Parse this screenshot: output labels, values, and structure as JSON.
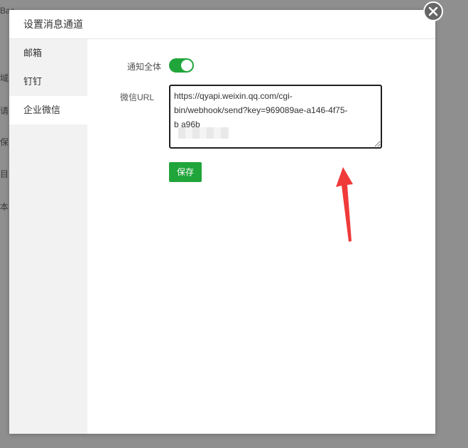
{
  "background": {
    "fragments": [
      "Bas",
      "域",
      "请",
      "保",
      "目",
      "本"
    ]
  },
  "modal": {
    "title": "设置消息通道",
    "close_icon": "close-icon"
  },
  "sidebar": {
    "items": [
      {
        "label": "邮箱",
        "active": false
      },
      {
        "label": "钉钉",
        "active": false
      },
      {
        "label": "企业微信",
        "active": true
      }
    ]
  },
  "form": {
    "notify_all_label": "通知全体",
    "notify_all_on": true,
    "url_label": "微信URL",
    "url_value_line1": "https://qyapi.weixin.qq.com/cgi-",
    "url_value_line2": "bin/webhook/send?key=969089ae-a146-4f75-",
    "url_value_line3": "b                a96b",
    "save_label": "保存"
  },
  "colors": {
    "accent": "#20a53a",
    "annotation_arrow": "#f03a3a"
  }
}
